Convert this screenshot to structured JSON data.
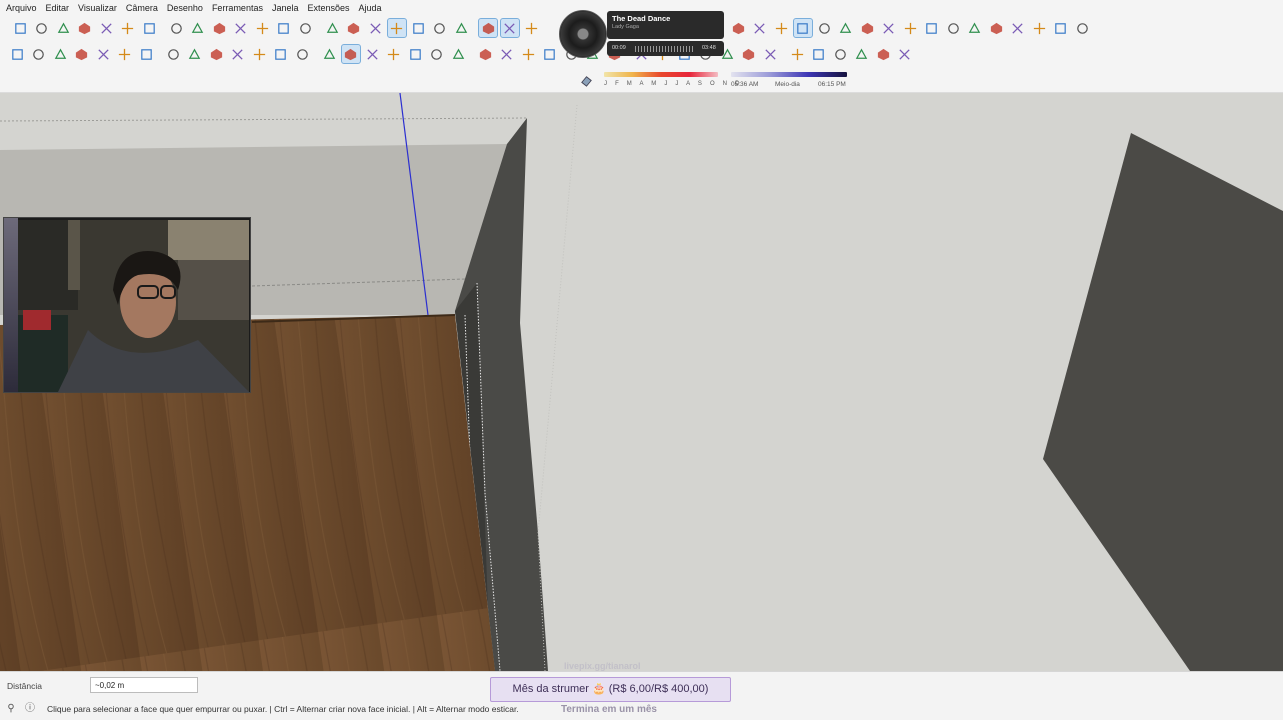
{
  "menu": [
    "Arquivo",
    "Editar",
    "Visualizar",
    "Câmera",
    "Desenho",
    "Ferramentas",
    "Janela",
    "Extensões",
    "Ajuda"
  ],
  "media": {
    "title": "The Dead Dance",
    "artist": "Lady Gaga",
    "elapsed": "00:09",
    "duration": "03:48"
  },
  "shadow": {
    "months": "J F M A M J J A S O N D",
    "time_start": "05:36 AM",
    "time_mid": "Meio-dia",
    "time_end": "06:15 PM"
  },
  "vcb": {
    "label": "Distância",
    "value": "~0,02 m"
  },
  "status": {
    "hint": "Clique para selecionar a face que quer empurrar ou puxar. | Ctrl = Alternar criar nova face inicial. | Alt = Alternar modo esticar."
  },
  "overlay": {
    "link": "livepix.gg/tianarol",
    "goal": "Mês da strumer 🎂 (R$ 6,00/R$ 400,00)",
    "goal_sub": "Termina em um mês"
  },
  "colors": {
    "viewport_bg": "#d4d4d0",
    "wood": "#6d4a2e",
    "blue_axis": "#2b2fd0",
    "dark_face": "#4b4a46",
    "active_tool": "#cfe3f5"
  },
  "tools_row1": [
    "new-file-icon",
    "open-icon",
    "save-icon",
    "cut-icon",
    "copy-icon",
    "paste-icon",
    "erase-icon",
    "undo-icon",
    "redo-icon",
    "print-icon",
    "model-info-icon",
    "iso-view-icon",
    "top-view-icon",
    "front-view-icon",
    "right-view-icon",
    "back-view-icon",
    "left-view-icon",
    "bottom-view-icon",
    "xray-icon",
    "back-edges-icon",
    "wireframe-icon",
    "hidden-line-icon",
    "shaded-icon",
    "shaded-textures-icon",
    "monochrome-icon",
    "section-plane-icon",
    "display-sections-icon",
    "section-cuts-icon",
    "add-location-icon",
    "toggle-terrain-icon",
    "warehouse-icon",
    "share-model-icon",
    "extension-warehouse-icon",
    "layout-icon",
    "extension-manager-icon",
    "trimble-connect-icon",
    "settings-icon",
    "export-icon",
    "info-icon",
    "cart-icon",
    "account-icon"
  ],
  "tools_row2": [
    "select-icon",
    "component-icon",
    "paint-bucket-icon",
    "eraser-icon",
    "line-icon",
    "freehand-icon",
    "rectangle-icon",
    "rotated-rect-icon",
    "circle-icon",
    "polygon-icon",
    "arc-icon",
    "two-point-arc-icon",
    "three-point-arc-icon",
    "pie-icon",
    "move-icon",
    "push-pull-icon",
    "rotate-icon",
    "follow-me-icon",
    "scale-icon",
    "offset-icon",
    "tape-measure-icon",
    "dimension-icon",
    "protractor-icon",
    "text-icon",
    "axes-icon",
    "3d-text-icon",
    "orbit-icon",
    "pan-icon",
    "zoom-icon",
    "zoom-window-icon",
    "zoom-extents-icon",
    "previous-view-icon",
    "position-camera-icon",
    "look-around-icon",
    "walk-icon",
    "sandbox-icon",
    "solid-tools-icon",
    "outer-shell-icon",
    "intersect-icon",
    "union-icon",
    "subtract-icon"
  ]
}
